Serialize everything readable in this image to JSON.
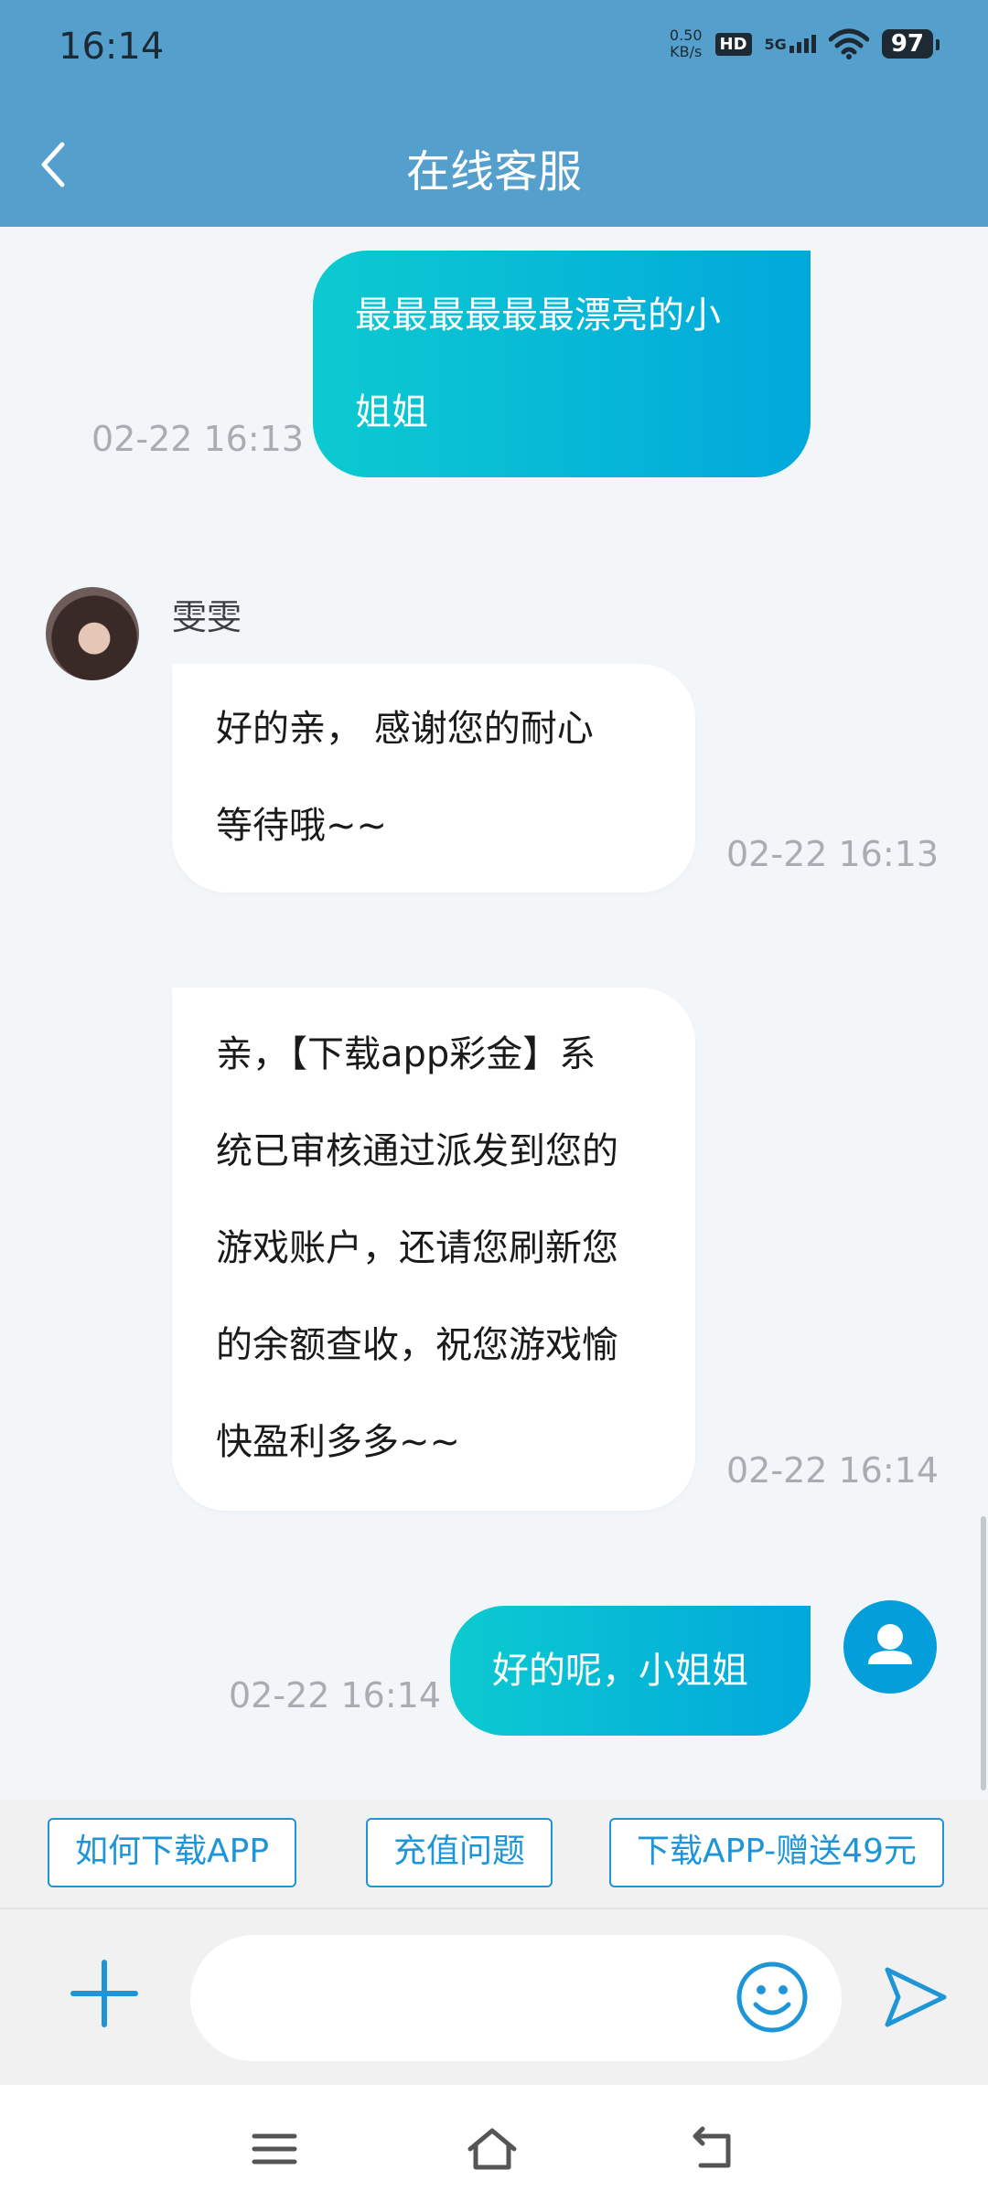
{
  "status_bar": {
    "time": "16:14",
    "net_speed_value": "0.50",
    "net_speed_unit": "KB/s",
    "hd": "HD",
    "network": "5G",
    "battery": "97"
  },
  "header": {
    "title": "在线客服",
    "back_icon": "chevron-left-icon"
  },
  "messages": [
    {
      "direction": "out",
      "lines": [
        "最最最最最最漂亮的小",
        "姐姐"
      ],
      "time": "02-22 16:13"
    },
    {
      "direction": "in",
      "sender": "雯雯",
      "lines": [
        "好的亲， 感谢您的耐心",
        "等待哦~~"
      ],
      "time": "02-22 16:13"
    },
    {
      "direction": "in",
      "lines": [
        "亲，【下载app彩金】系",
        "统已审核通过派发到您的",
        "游戏账户，还请您刷新您",
        "的余额查收，祝您游戏愉",
        "快盈利多多~~"
      ],
      "time": "02-22 16:14"
    },
    {
      "direction": "out",
      "lines": [
        "好的呢，小姐姐"
      ],
      "time": "02-22 16:14"
    }
  ],
  "quick_replies": [
    "如何下载APP",
    "充值问题",
    "下载APP-赠送49元"
  ],
  "input": {
    "value": "",
    "placeholder": ""
  },
  "icons": {
    "plus": "plus-icon",
    "emoji": "smiley-icon",
    "send": "send-icon",
    "user_avatar": "user-icon",
    "nav_menu": "menu-icon",
    "nav_home": "home-icon",
    "nav_back": "back-icon"
  },
  "colors": {
    "header": "#559fcd",
    "accent": "#1d95d6",
    "bubble_out_start": "#0ccad0",
    "bubble_out_end": "#01a8dc"
  }
}
